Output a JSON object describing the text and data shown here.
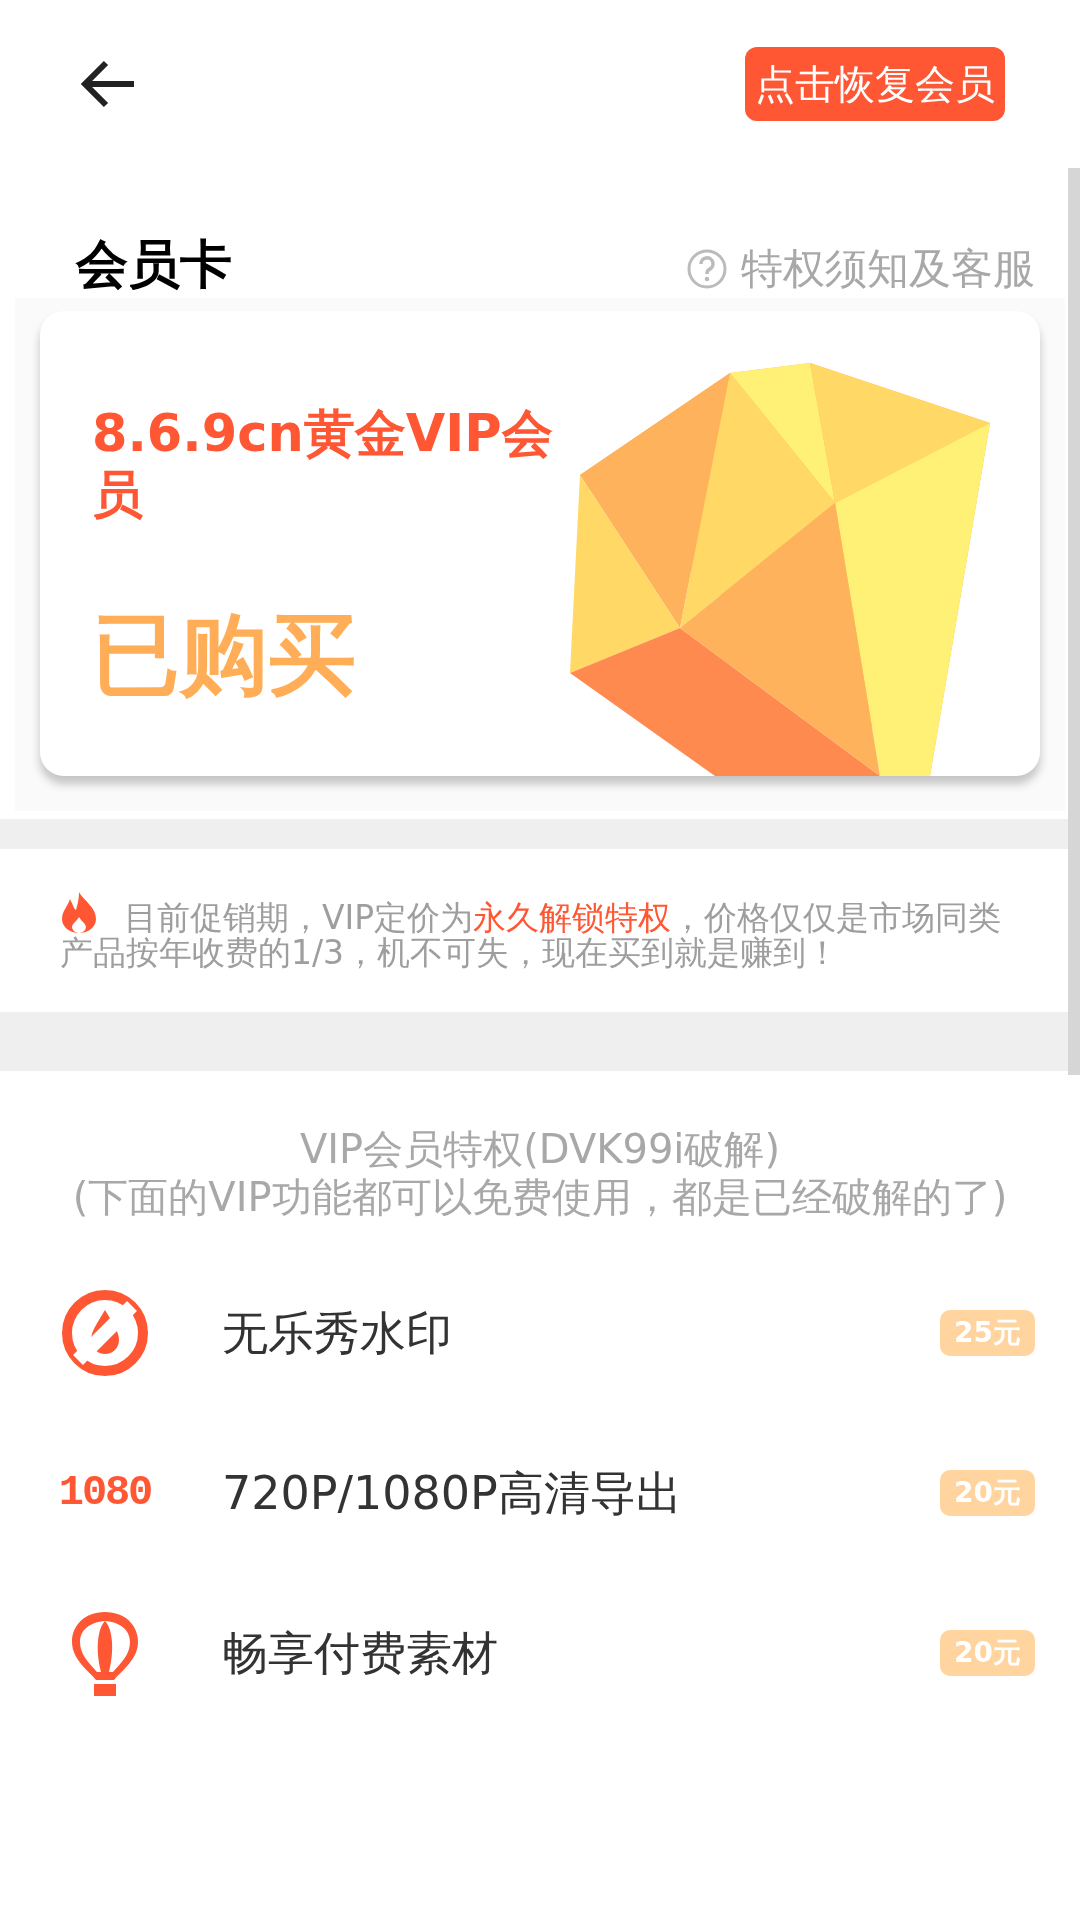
{
  "header": {
    "restore_button": "点击恢复会员"
  },
  "card_section": {
    "title": "会员卡",
    "help_link": "特权须知及客服"
  },
  "vip_card": {
    "name": "8.6.9cn黄金VIP会员",
    "status": "已购买"
  },
  "promo": {
    "text": "目前促销期，VIP定价为**永久解锁特权**，价格仅仅是市场同类产品按年收费的1/3，机不可失，现在买到就是赚到！"
  },
  "privileges": {
    "title": "VIP会员特权(DVK99i破解)",
    "subtitle": "(下面的VIP功能都可以免费使用，都是已经破解的了)",
    "items": [
      {
        "kind": "no-watermark",
        "label": "无乐秀水印",
        "price": "25元"
      },
      {
        "kind": "resolution",
        "icon_text": "1080",
        "label": "720P/1080P高清导出",
        "price": "20元"
      },
      {
        "kind": "balloon",
        "label": "畅享付费素材",
        "price": "20元"
      }
    ]
  }
}
